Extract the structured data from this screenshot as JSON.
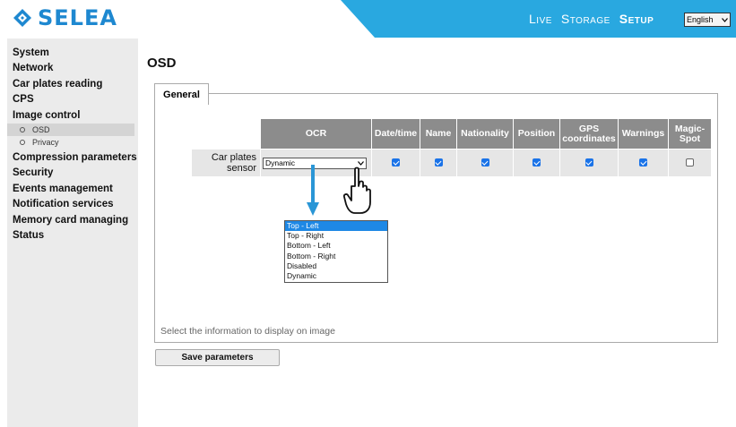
{
  "header": {
    "brand": "SELEA",
    "nav": [
      "Live",
      "Storage",
      "Setup"
    ],
    "active_nav": "Setup",
    "language": "English",
    "brand_color": "#1e88d0",
    "accent_color": "#29a8e0"
  },
  "sidebar": {
    "items": [
      {
        "label": "System"
      },
      {
        "label": "Network"
      },
      {
        "label": "Car plates reading"
      },
      {
        "label": "CPS"
      },
      {
        "label": "Image control"
      }
    ],
    "subitems": [
      {
        "label": "OSD",
        "selected": true
      },
      {
        "label": "Privacy",
        "selected": false
      }
    ],
    "items_after": [
      {
        "label": "Compression parameters"
      },
      {
        "label": "Security"
      },
      {
        "label": "Events management"
      },
      {
        "label": "Notification services"
      },
      {
        "label": "Memory card managing"
      },
      {
        "label": "Status"
      }
    ]
  },
  "main": {
    "title": "OSD",
    "tab": "General",
    "table": {
      "columns": [
        "OCR",
        "Date/time",
        "Name",
        "Nationality",
        "Position",
        "GPS coordinates",
        "Warnings",
        "Magic-Spot"
      ],
      "row_label": "Car plates sensor",
      "ocr_value": "Dynamic",
      "checks": [
        true,
        true,
        true,
        true,
        true,
        true,
        false
      ]
    },
    "dropdown_options": [
      "Top - Left",
      "Top - Right",
      "Bottom - Left",
      "Bottom - Right",
      "Disabled",
      "Dynamic"
    ],
    "highlighted_option": "Top - Left",
    "hint": "Select the information to display on image",
    "save_label": "Save parameters"
  }
}
